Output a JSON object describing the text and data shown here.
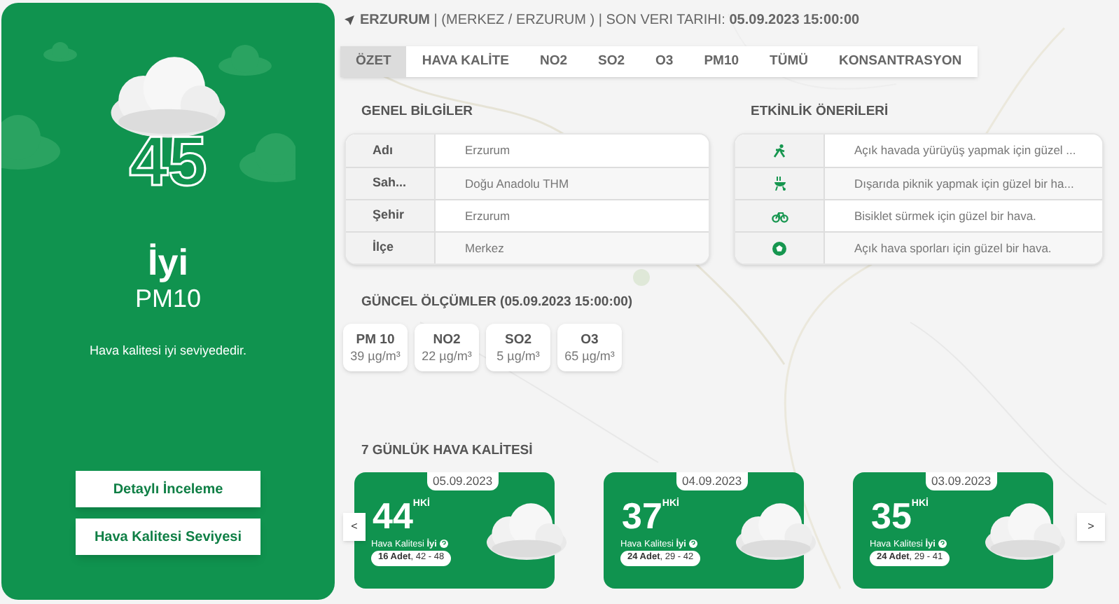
{
  "summary": {
    "value": "45",
    "quality": "İyi",
    "pollutant": "PM10",
    "message": "Hava kalitesi iyi seviyededir.",
    "buttons": [
      "Detaylı İnceleme",
      "Hava Kalitesi Seviyesi"
    ]
  },
  "header": "**ERZURUM** | (MERKEZ / ERZURUM ) | SON VERI TARIHI: **05.09.2023 15:00:00**",
  "tabs": [
    {
      "label": "ÖZET",
      "selected": true
    },
    {
      "label": "HAVA KALİTE",
      "selected": false
    },
    {
      "label": "NO2",
      "selected": false
    },
    {
      "label": "SO2",
      "selected": false
    },
    {
      "label": "O3",
      "selected": false
    },
    {
      "label": "PM10",
      "selected": false
    },
    {
      "label": "TÜMÜ",
      "selected": false
    },
    {
      "label": "KONSANTRASYON",
      "selected": false
    }
  ],
  "general_info": {
    "title": "GENEL BİLGİLER",
    "rows": [
      {
        "label": "Adı",
        "value": "Erzurum"
      },
      {
        "label": "Sah...",
        "value": "Doğu Anadolu THM"
      },
      {
        "label": "Şehir",
        "value": "Erzurum"
      },
      {
        "label": "İlçe",
        "value": "Merkez"
      }
    ]
  },
  "activities": {
    "title": "ETKİNLİK ÖNERİLERİ",
    "rows": [
      {
        "kind": "walk",
        "text": "Açık havada yürüyüş yapmak için güzel ..."
      },
      {
        "kind": "picnic",
        "text": "Dışarıda piknik yapmak için güzel bir ha..."
      },
      {
        "kind": "bike",
        "text": "Bisiklet sürmek için güzel bir hava."
      },
      {
        "kind": "ball",
        "text": "Açık hava sporları için güzel bir hava."
      }
    ]
  },
  "measurements": {
    "title": "GÜNCEL ÖLÇÜMLER (05.09.2023 15:00:00)",
    "items": [
      {
        "name": "PM 10",
        "value": "39 µg/m³"
      },
      {
        "name": "NO2",
        "value": "22 µg/m³"
      },
      {
        "name": "SO2",
        "value": "5 µg/m³"
      },
      {
        "name": "O3",
        "value": "65 µg/m³"
      }
    ]
  },
  "forecast": {
    "title": "7 GÜNLÜK HAVA KALİTESİ",
    "prev": "<",
    "next": ">",
    "days": [
      {
        "date": "05.09.2023",
        "value": "44",
        "unit": "HKİ",
        "quality": "Hava Kalitesi **İyi**",
        "count": "**16 Adet**, 42 - 48"
      },
      {
        "date": "04.09.2023",
        "value": "37",
        "unit": "HKİ",
        "quality": "Hava Kalitesi **İyi**",
        "count": "**24 Adet**, 29 - 42"
      },
      {
        "date": "03.09.2023",
        "value": "35",
        "unit": "HKİ",
        "quality": "Hava Kalitesi **İyi**",
        "count": "**24 Adet**, 29 - 41"
      }
    ]
  }
}
